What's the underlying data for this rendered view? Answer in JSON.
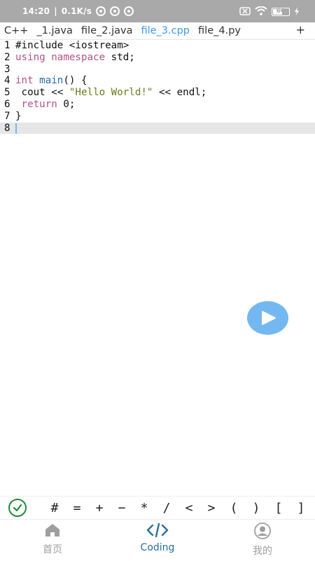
{
  "status_bar": {
    "time": "14:20",
    "net_speed": "0.1K/s",
    "battery": "60",
    "battery_level": 0.6
  },
  "tabs": [
    {
      "label": "C++",
      "active": false
    },
    {
      "label": "_1.java",
      "active": false
    },
    {
      "label": "file_2.java",
      "active": false
    },
    {
      "label": "file_3.cpp",
      "active": true
    },
    {
      "label": "file_4.py",
      "active": false
    }
  ],
  "add_tab_label": "+",
  "editor": {
    "line_numbers": [
      "1",
      "2",
      "3",
      "4",
      "5",
      "6",
      "7",
      "8"
    ],
    "lines": {
      "l1": "#include <iostream>",
      "l2_kw1": "using",
      "l2_kw2": "namespace",
      "l2_rest": " std;",
      "l4_kw": "int",
      "l4_fn": "main",
      "l4_rest": "() {",
      "l5_a": " cout << ",
      "l5_str": "\"Hello World!\"",
      "l5_b": " << endl;",
      "l6_kw": " return",
      "l6_rest": " 0;",
      "l7": "}"
    },
    "current_line": 8
  },
  "run_button": {
    "icon": "play-icon",
    "color": "#74b8f2"
  },
  "symbols": [
    "#",
    "=",
    "+",
    "−",
    "*",
    "/",
    "<",
    ">",
    "(",
    ")",
    "[",
    "]",
    "{"
  ],
  "bottom_nav": [
    {
      "label": "首页",
      "icon": "home-icon",
      "active": false
    },
    {
      "label": "Coding",
      "icon": "code-icon",
      "active": true
    },
    {
      "label": "我的",
      "icon": "profile-icon",
      "active": false
    }
  ],
  "colors": {
    "accent": "#3d9ae6",
    "keyword": "#b1528a",
    "function": "#2a6ea8",
    "string": "#6b7c1e",
    "check": "#1f8a3b"
  }
}
